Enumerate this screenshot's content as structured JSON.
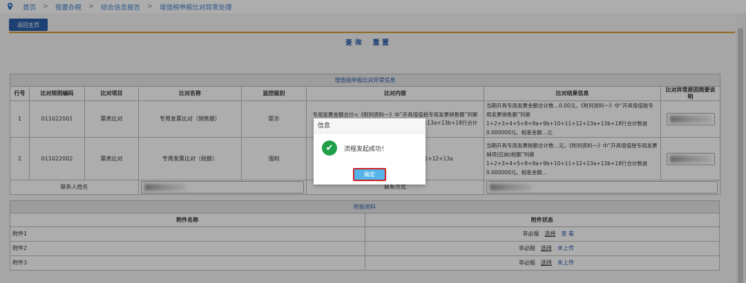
{
  "breadcrumb": [
    "首页",
    "我要办税",
    "综合信息报告",
    "增值税申报比对异常处理"
  ],
  "back_button": "返回主页",
  "actions": {
    "query": "查 询",
    "reset": "重 置"
  },
  "main_table": {
    "title": "增值税申报比对异常信息",
    "headers": [
      "行号",
      "比对规则编码",
      "比对项目",
      "比对名称",
      "监控级别",
      "比对内容",
      "比对结果信息",
      "比对异常原因简要说明"
    ],
    "rows": [
      {
        "no": "1",
        "code": "011022001",
        "item": "票表比对",
        "name": "专用发票比对（销售额）",
        "level": "提示",
        "content": "专用发票金额合计=《附列资料一》中“开具增值税专用发票销售额”列第1+2+3+4a+4b+5+8+9a+9b+10+11+12+13a+13b+18行合计",
        "result": "当期开具专用发票金额合计数…0.00元，《附列资料一》中“开具增值税专用发票销售额”列第1+2+3+4+5+8+9a+9b+10+11+12+13a+13b+18行合计数是0.000000元。相差金额…元"
      },
      {
        "no": "2",
        "code": "011022002",
        "item": "票表比对",
        "name": "专用发票比对（税额）",
        "level": "强制",
        "content": "（…增值税专用发票销项…9b+10+11+12+13a",
        "result": "当期开具专用发票税额合计数…元，《附列资料一》中“开具增值税专用发票销项(应纳)税额”列第1+2+3+4+5+8+9a+9b+10+11+12+13a+13b+18行合计数是0.000000元。相差金额…"
      }
    ],
    "contact_name_label": "联系人姓名",
    "contact_method_label": "联系方式"
  },
  "attach_table": {
    "title": "附报资料",
    "headers": [
      "附件名称",
      "附件状态"
    ],
    "rows": [
      {
        "name": "附件1",
        "required": "非必报",
        "choose": "选择",
        "action": "查 看"
      },
      {
        "name": "附件2",
        "required": "非必报",
        "choose": "选择",
        "action": "未上传"
      },
      {
        "name": "附件3",
        "required": "非必报",
        "choose": "选择",
        "action": "未上传"
      }
    ]
  },
  "dialog": {
    "title": "信息",
    "message": "流程发起成功！",
    "ok": "确定"
  }
}
